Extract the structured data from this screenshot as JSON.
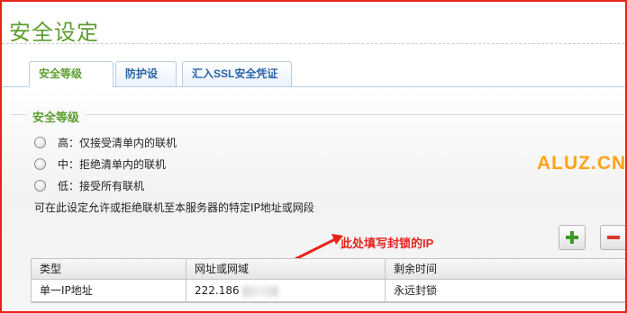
{
  "page": {
    "title": "安全设定"
  },
  "tabs": [
    {
      "label": "安全等级",
      "active": true
    },
    {
      "label": "防护设定",
      "active": false
    },
    {
      "label": "汇入SSL安全凭证",
      "active": false
    }
  ],
  "security_level": {
    "legend": "安全等级",
    "options": [
      {
        "label": "高：仅接受清单内的联机"
      },
      {
        "label": "中：拒绝清单内的联机"
      },
      {
        "label": "低：接受所有联机"
      }
    ],
    "description": "可在此设定允许或拒绝联机至本服务器的特定IP地址或网段"
  },
  "toolbar": {
    "add_icon": "plus-icon",
    "remove_icon": "minus-icon"
  },
  "table": {
    "headers": [
      "类型",
      "网址或网域",
      "剩余时间"
    ],
    "rows": [
      {
        "type": "单一IP地址",
        "address": "222.186",
        "remaining": "永远封锁"
      }
    ]
  },
  "annotation": {
    "text": "此处填写封锁的IP"
  },
  "watermark": {
    "text": "ALUZ.CN"
  },
  "colors": {
    "frame": "#e8231c",
    "accent_green": "#5d9e2f",
    "tab_blue": "#2b62a8",
    "annotation_red": "#e8231c",
    "watermark_orange": "#ffa21a"
  }
}
